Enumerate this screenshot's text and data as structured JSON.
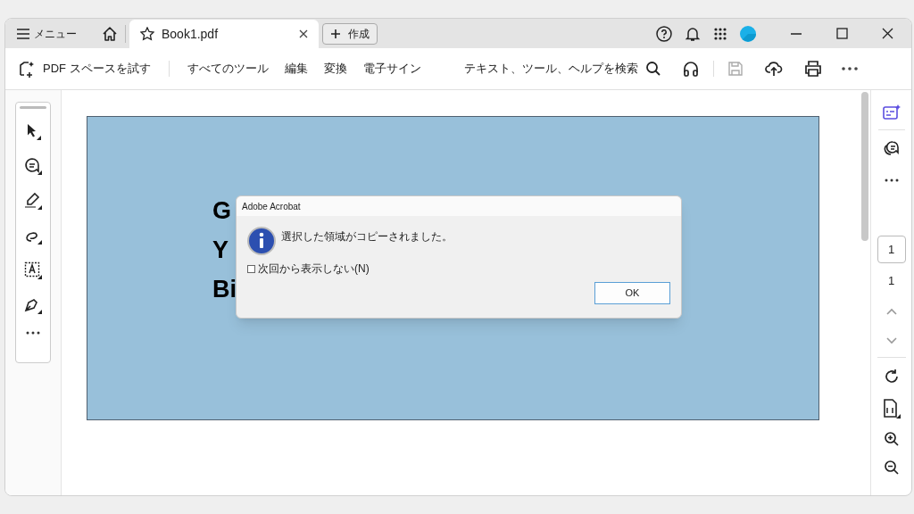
{
  "tabbar": {
    "menu_label": "メニュー",
    "tabs": [
      {
        "label": "Book1.pdf",
        "selected": true
      }
    ],
    "create_button": "作成"
  },
  "toolbar": {
    "try_space": "PDF スペースを試す",
    "menus": [
      "すべてのツール",
      "編集",
      "変換",
      "電子サイン"
    ],
    "search_label": "テキスト、ツール、ヘルプを検索"
  },
  "document": {
    "lines": [
      "G",
      "Y",
      "Bi"
    ]
  },
  "dialog": {
    "title": "Adobe Acrobat",
    "message": "選択した領域がコピーされました。",
    "checkbox": {
      "label": "次回から表示しない(N)",
      "checked": false
    },
    "button": "OK"
  },
  "page_nav": {
    "current_page": "1",
    "page_count": "1"
  }
}
